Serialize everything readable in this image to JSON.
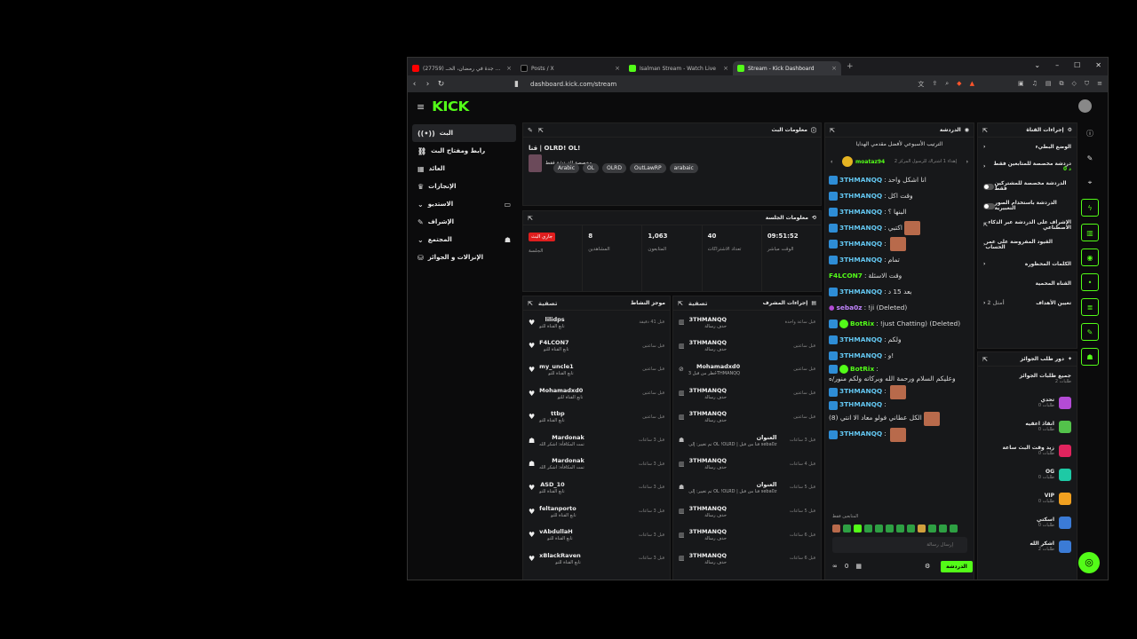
{
  "browser": {
    "tabs": [
      {
        "title": "(27759) أكبر شوارع جدة في رمضان، الحــ",
        "icon": "youtube-icon",
        "color": "#ff0000"
      },
      {
        "title": "Posts / X",
        "icon": "x-icon",
        "color": "#000000"
      },
      {
        "title": "Isalman Stream - Watch Live",
        "icon": "kick-icon",
        "color": "#53fc18"
      },
      {
        "title": "Stream - Kick Dashboard",
        "icon": "kick-icon",
        "color": "#53fc18"
      }
    ],
    "url": "dashboard.kick.com/stream"
  },
  "app": {
    "logo": "KICK"
  },
  "sidebar": {
    "items": [
      {
        "label": "البث",
        "icon": "broadcast-icon"
      },
      {
        "label": "رابط ومفتاح البث",
        "icon": "link-icon"
      },
      {
        "label": "العائد",
        "icon": "revenue-icon"
      },
      {
        "label": "الإنجازات",
        "icon": "trophy-icon"
      },
      {
        "label": "الاستديو",
        "icon": "studio-icon"
      },
      {
        "label": "الإشراف",
        "icon": "wrench-icon"
      },
      {
        "label": "المجتمع",
        "icon": "community-icon"
      },
      {
        "label": "الإنزالات و الجوائز",
        "icon": "drops-icon"
      }
    ]
  },
  "stream_info": {
    "header": "معلومات البث",
    "title": "قنا | OLRD! OL!",
    "category": "مخصصة للدردشة فقط",
    "tags": [
      "Arabic",
      "OL",
      "OLRD",
      "OutLawRP",
      "arabaic"
    ]
  },
  "session": {
    "header": "معلومات الجلسة",
    "stats": [
      {
        "value": "جاري البث",
        "label": "الجلسة"
      },
      {
        "value": "8",
        "label": "المشاهدين"
      },
      {
        "value": "1,063",
        "label": "المتابعون"
      },
      {
        "value": "40",
        "label": "تعداد الاشتراكات"
      },
      {
        "value": "09:51:52",
        "label": "الوقت مباشر"
      }
    ]
  },
  "activity": {
    "header": "موجز النشاط",
    "filter": "تصفية",
    "items": [
      {
        "name": "lilidps",
        "sub": "تابع القناة للتو",
        "time": "قبل 41 دقيقة"
      },
      {
        "name": "F4LCON7",
        "sub": "تابع القناة للتو",
        "time": "قبل ساعتين"
      },
      {
        "name": "my_uncle1",
        "sub": "تابع القناة للتو",
        "time": "قبل ساعتين"
      },
      {
        "name": "Mohamadxd0",
        "sub": "تابع القناة للتو",
        "time": "قبل ساعتين"
      },
      {
        "name": "ttbp",
        "sub": "تابع القناة للتو",
        "time": "قبل ساعتين"
      },
      {
        "name": "Mardonak",
        "sub": "تمت المكافأة: اشكر الله",
        "time": "قبل 3 ساعات"
      },
      {
        "name": "Mardonak",
        "sub": "تمت المكافأة: اشكر الله",
        "time": "قبل 3 ساعات"
      },
      {
        "name": "ASD_10",
        "sub": "تابع القناة للتو",
        "time": "قبل 3 ساعات"
      },
      {
        "name": "feltanporto",
        "sub": "تابع القناة للتو",
        "time": "قبل 3 ساعات"
      },
      {
        "name": "vAbdullaH",
        "sub": "تابع القناة للتو",
        "time": "قبل 3 ساعات"
      },
      {
        "name": "xBlackRaven",
        "sub": "تابع القناة للتو",
        "time": "قبل 3 ساعات"
      }
    ]
  },
  "modlog": {
    "header": "إجراءات المشرف",
    "filter": "تصفية",
    "items": [
      {
        "name": "3THMANQQ",
        "sub": "حذف رسالة",
        "time": "قبل ساعة واحدة"
      },
      {
        "name": "3THMANQQ",
        "sub": "حذف رسالة",
        "time": "قبل ساعتين"
      },
      {
        "name": "Mohamadxd0",
        "sub": "حُظر من قبل 3THMANQQ",
        "time": "قبل ساعتين"
      },
      {
        "name": "3THMANQQ",
        "sub": "حذف رسالة",
        "time": "قبل ساعتين"
      },
      {
        "name": "3THMANQQ",
        "sub": "حذف رسالة",
        "time": "قبل ساعتين"
      },
      {
        "name": "العنوان",
        "sub": "تم تغيير: إلى OL !OLRD | قنا من قبل seba0z",
        "time": "قبل 3 ساعات"
      },
      {
        "name": "3THMANQQ",
        "sub": "حذف رسالة",
        "time": "قبل 4 ساعات"
      },
      {
        "name": "العنوان",
        "sub": "تم تغيير: إلى OL !OLRD | قنا من قبل seba0z",
        "time": "قبل 5 ساعات"
      },
      {
        "name": "3THMANQQ",
        "sub": "حذف رسالة",
        "time": "قبل 5 ساعات"
      },
      {
        "name": "3THMANQQ",
        "sub": "حذف رسالة",
        "time": "قبل 6 ساعات"
      },
      {
        "name": "3THMANQQ",
        "sub": "حذف رسالة",
        "time": "قبل 6 ساعات"
      }
    ]
  },
  "chat": {
    "header": "الدردشة",
    "pinned_title": "الترتيب الأسبوعي لأفضل مقدمي الهدايا",
    "top_gifter": "moataz94",
    "top_gifter_sub": "إهداء 1 اشتراك للرسول المركز 2",
    "messages": [
      {
        "user": "3THMANQQ",
        "text": "انا اشكل واحد"
      },
      {
        "user": "3THMANQQ",
        "text": "وقت اكل"
      },
      {
        "user": "3THMANQQ",
        "text": "البنها ؟"
      },
      {
        "user": "3THMANQQ",
        "text": "اكتبي"
      },
      {
        "user": "3THMANQQ",
        "text": ""
      },
      {
        "user": "3THMANQQ",
        "text": "تمام"
      },
      {
        "user": "F4LCON7",
        "text": "وقت الاسئلة"
      },
      {
        "user": "3THMANQQ",
        "text": "بعد 15 د"
      },
      {
        "user": "seba0z",
        "text": "!ji (Deleted)"
      },
      {
        "user": "BotRix",
        "text": "!just Chatting) (Deleted)"
      },
      {
        "user": "3THMANQQ",
        "text": "ولكم"
      },
      {
        "user": "3THMANQQ",
        "text": "و!"
      },
      {
        "user": "BotRix",
        "text": "وعليكم السلام ورحمة الله وبركاته ولكم منور/ه"
      },
      {
        "user": "3THMANQQ",
        "text": ""
      },
      {
        "user": "3THMANQQ",
        "text": "الكل عطاني فولو معاد الا انتي (8)"
      },
      {
        "user": "3THMANQQ",
        "text": ""
      }
    ],
    "followers_only": "المتابعين فقط",
    "input_placeholder": "إرسال رسالة",
    "send_label": "الدردشة",
    "count": "0"
  },
  "channel_actions": {
    "header": "إجراءات القناة",
    "items": [
      {
        "label": "الوضع البطيء"
      },
      {
        "label": "دردشة مخصصة للمتابعين فقط",
        "extra": "0 د"
      },
      {
        "label": "الدردشة مخصصة للمشتركين فقط"
      },
      {
        "label": "الدردشة باستخدام الصور التعبيرية"
      },
      {
        "label": "الإشراف على الدردشة عبر الذكاء الاصطناعي"
      },
      {
        "label": "القيود المفروضة على عمر الحساب"
      },
      {
        "label": "الكلمات المحظورة"
      },
      {
        "label": "القناة المحمية"
      },
      {
        "label": "تعيين الأهداف",
        "extra": "أمثل 2"
      }
    ]
  },
  "rewards": {
    "header": "دور طلب الجوائز",
    "all": "جميع طلبات الجوائز",
    "all_count": "2 طلبات",
    "items": [
      {
        "title": "تحدي",
        "sub": "0 طلبات",
        "color": "#b44bd6"
      },
      {
        "title": "انقاذ اعقيه",
        "sub": "0 طلبات",
        "color": "#53c24b"
      },
      {
        "title": "زيد وقت البث ساعة",
        "sub": "0 طلبات",
        "color": "#e0245e"
      },
      {
        "title": "OG",
        "sub": "0 طلبات",
        "color": "#1ec9a5"
      },
      {
        "title": "VIP",
        "sub": "0 طلبات",
        "color": "#f0a020"
      },
      {
        "title": "اسكتي",
        "sub": "0 طلبات",
        "color": "#3b7bd6"
      },
      {
        "title": "اشكر الله",
        "sub": "2 طلبات",
        "color": "#3b7bd6"
      }
    ]
  }
}
